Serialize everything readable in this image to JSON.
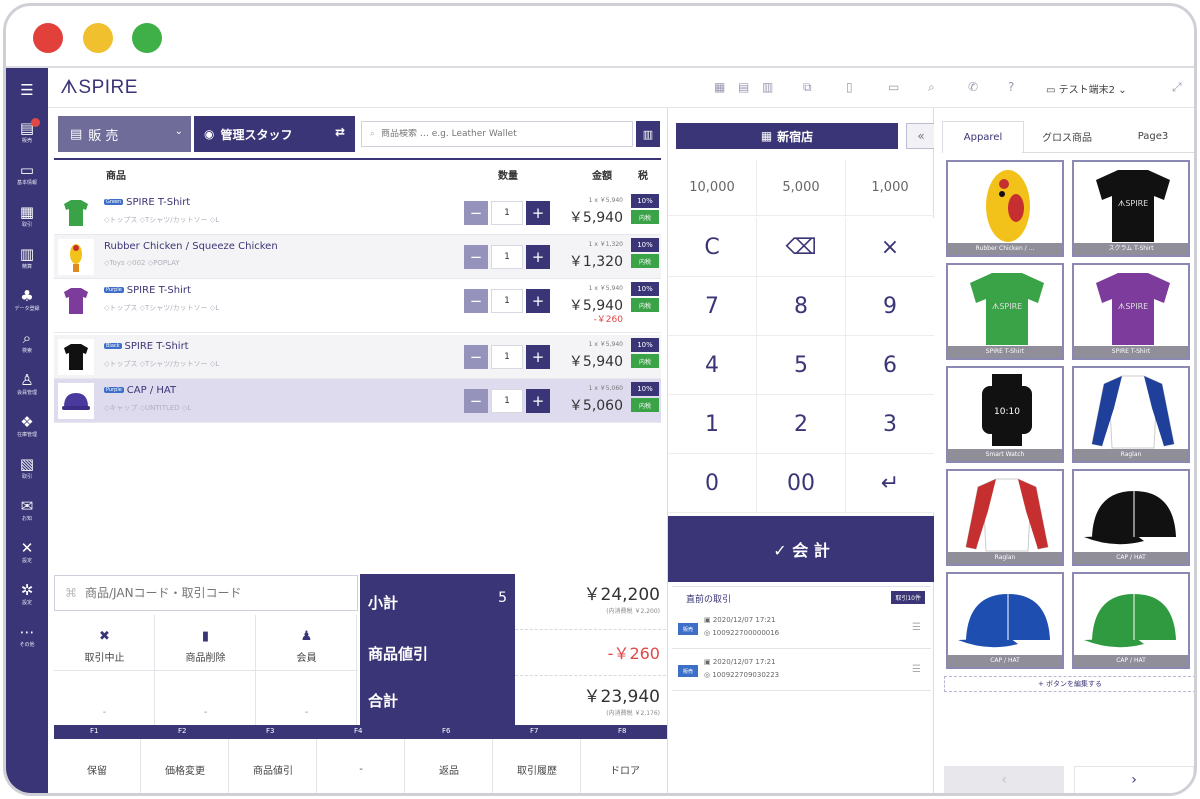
{
  "header": {
    "logo": "SPIRE",
    "terminal": "テスト端末2"
  },
  "nav": [
    {
      "icon": "☰",
      "label": ""
    },
    {
      "icon": "▤",
      "label": "販売"
    },
    {
      "icon": "▭",
      "label": "基本情報"
    },
    {
      "icon": "▦",
      "label": "取引"
    },
    {
      "icon": "▥",
      "label": "精算"
    },
    {
      "icon": "♣",
      "label": "データ登録"
    },
    {
      "icon": "⌕",
      "label": "検索"
    },
    {
      "icon": "♙",
      "label": "会員管理"
    },
    {
      "icon": "❖",
      "label": "在庫管理"
    },
    {
      "icon": "▧",
      "label": "取引"
    },
    {
      "icon": "✉",
      "label": "お知"
    },
    {
      "icon": "✕",
      "label": "設定"
    },
    {
      "icon": "✲",
      "label": "設定"
    },
    {
      "icon": "⋯",
      "label": "その他"
    }
  ],
  "cart": {
    "mode": "販 売",
    "staff": "管理スタッフ",
    "search_placeholder": "商品検索 … e.g. Leather Wallet",
    "columns": {
      "product": "商品",
      "qty": "数量",
      "amount": "金額",
      "tax": "税"
    },
    "items": [
      {
        "tag": "Green",
        "name": "SPIRE T-Shirt",
        "meta": "◇トップス ◇Tシャツ/カットソー ◇L",
        "qty": "1",
        "unit": "1 x ￥5,940",
        "price": "￥5,940",
        "discount": "",
        "tax": "10%",
        "tax_type": "内税"
      },
      {
        "tag": "",
        "name": "Rubber Chicken / Squeeze Chicken",
        "meta": "◇Toys ◇002 ◇POPLAY",
        "qty": "1",
        "unit": "1 x ￥1,320",
        "price": "￥1,320",
        "discount": "",
        "tax": "10%",
        "tax_type": "内税"
      },
      {
        "tag": "Purple",
        "name": "SPIRE T-Shirt",
        "meta": "◇トップス ◇Tシャツ/カットソー ◇L",
        "qty": "1",
        "unit": "1 x ￥5,940",
        "price": "￥5,940",
        "discount": "-￥260",
        "tax": "10%",
        "tax_type": "内税"
      },
      {
        "tag": "Black",
        "name": "SPIRE T-Shirt",
        "meta": "◇トップス ◇Tシャツ/カットソー ◇L",
        "qty": "1",
        "unit": "1 x ￥5,940",
        "price": "￥5,940",
        "discount": "",
        "tax": "10%",
        "tax_type": "内税"
      },
      {
        "tag": "Purple",
        "name": "CAP / HAT",
        "meta": "◇キャップ ◇UNTITLED ◇L",
        "qty": "1",
        "unit": "1 x ￥5,060",
        "price": "￥5,060",
        "discount": "",
        "tax": "10%",
        "tax_type": "内税"
      }
    ],
    "code_placeholder": "商品/JANコード・取引コード",
    "actions": [
      {
        "icon": "✖",
        "label": "取引中止"
      },
      {
        "icon": "▮",
        "label": "商品削除"
      },
      {
        "icon": "♟",
        "label": "会員"
      }
    ],
    "dash": "-",
    "summary": {
      "subtotal_label": "小計",
      "count": "5",
      "subtotal": "￥24,200",
      "subtotal_tax": "(内消費税 ￥2,200)",
      "discount_label": "商品値引",
      "discount": "-￥260",
      "total_label": "合計",
      "total": "￥23,940",
      "total_tax": "(内消費税 ￥2,176)"
    },
    "fkeys": [
      {
        "key": "F1",
        "label": "保留"
      },
      {
        "key": "F2",
        "label": "価格変更"
      },
      {
        "key": "F3",
        "label": "商品値引"
      },
      {
        "key": "F4",
        "label": "-"
      },
      {
        "key": "F6",
        "label": "返品"
      },
      {
        "key": "F7",
        "label": "取引履歴"
      },
      {
        "key": "F8",
        "label": "ドロア"
      }
    ]
  },
  "pad": {
    "store": "新宿店",
    "quick_amounts": [
      "10,000",
      "5,000",
      "1,000"
    ],
    "keys": [
      "C",
      "⌫",
      "×",
      "7",
      "8",
      "9",
      "4",
      "5",
      "6",
      "1",
      "2",
      "3",
      "0",
      "00",
      "↵"
    ],
    "pay": "✓ 会 計",
    "history_title": "直前の取引",
    "history_badge": "取引10件",
    "history": [
      {
        "badge": "販売",
        "time": "▣ 2020/12/07 17:21",
        "number": "◎ 100922700000016"
      },
      {
        "badge": "販売",
        "time": "▣ 2020/12/07 17:21",
        "number": "◎ 100922709030223"
      }
    ]
  },
  "grid": {
    "tabs": [
      "Apparel",
      "グロス商品",
      "Page3"
    ],
    "tiles": [
      {
        "caption": "Rubber Chicken / ...",
        "color": "#f2c21b"
      },
      {
        "caption": "スクラム T-Shirt",
        "color": "#111111"
      },
      {
        "caption": "SPIRE T-Shirt",
        "color": "#3aa348"
      },
      {
        "caption": "SPIRE T-Shirt",
        "color": "#7d3b9b"
      },
      {
        "caption": "Smart Watch",
        "color": "#111111"
      },
      {
        "caption": "Raglan",
        "color": "#1e3f9a"
      },
      {
        "caption": "Raglan",
        "color": "#c62f2f"
      },
      {
        "caption": "CAP / HAT",
        "color": "#111111"
      },
      {
        "caption": "CAP / HAT",
        "color": "#1e4fb0"
      },
      {
        "caption": "CAP / HAT",
        "color": "#2f9a3f"
      }
    ],
    "edit_label": "+ ボタンを編集する",
    "prev": "‹",
    "next": "›"
  }
}
